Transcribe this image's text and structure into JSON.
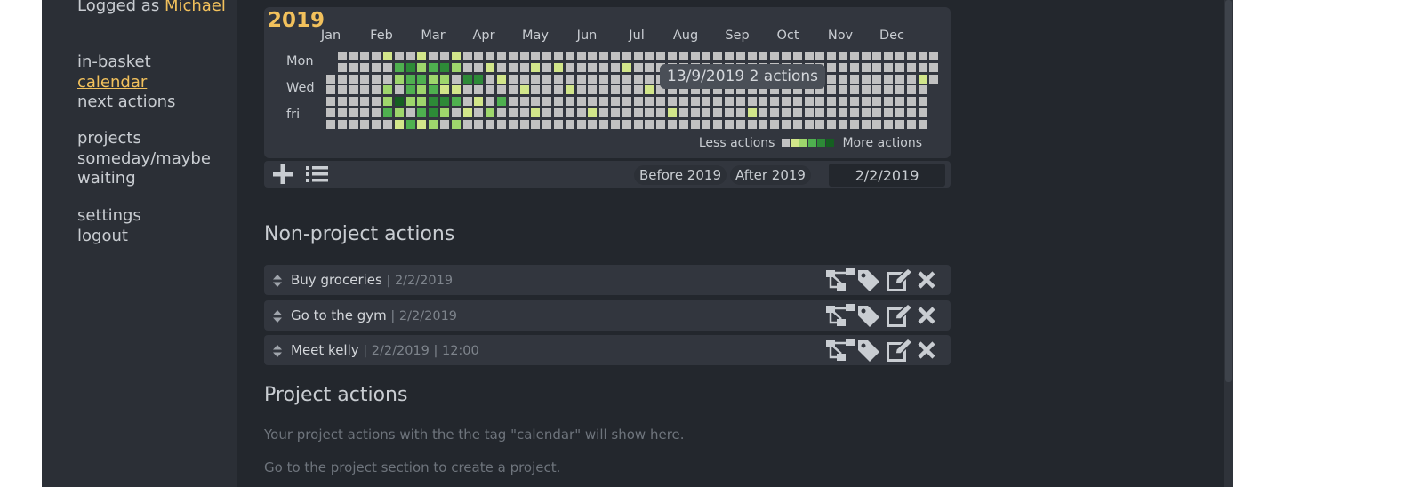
{
  "sidebar": {
    "logged_prefix": "Logged as ",
    "user_name": "Michael",
    "nav_main": [
      "in-basket",
      "calendar",
      "next actions"
    ],
    "nav_projects": [
      "projects",
      "someday/maybe",
      "waiting"
    ],
    "nav_account": [
      "settings",
      "logout"
    ],
    "active": "calendar"
  },
  "calendar": {
    "year": "2019",
    "months": [
      "Jan",
      "Feb",
      "Mar",
      "Apr",
      "May",
      "Jun",
      "Jul",
      "Aug",
      "Sep",
      "Oct",
      "Nov",
      "Dec"
    ],
    "day_labels": [
      "Mon",
      "Wed",
      "fri"
    ],
    "legend_less": "Less actions",
    "legend_more": "More actions",
    "legend_colors": [
      "#c1c1c1",
      "#d2e68a",
      "#9ed66c",
      "#4fb04f",
      "#2d8a37",
      "#155f21"
    ],
    "tooltip": "13/9/2019 2 actions",
    "empty_color": "#c1c1c1",
    "colors": [
      "#d2e68a",
      "#9ed66c",
      "#4fb04f",
      "#2d8a37",
      "#155f21"
    ],
    "highlights": [
      {
        "week": 5,
        "day": 0,
        "level": 0
      },
      {
        "week": 5,
        "day": 3,
        "level": 1
      },
      {
        "week": 5,
        "day": 4,
        "level": 1
      },
      {
        "week": 5,
        "day": 5,
        "level": 2
      },
      {
        "week": 6,
        "day": 1,
        "level": 2
      },
      {
        "week": 6,
        "day": 2,
        "level": 1
      },
      {
        "week": 6,
        "day": 4,
        "level": 4
      },
      {
        "week": 6,
        "day": 5,
        "level": 1
      },
      {
        "week": 6,
        "day": 6,
        "level": 0
      },
      {
        "week": 7,
        "day": 1,
        "level": 3
      },
      {
        "week": 7,
        "day": 2,
        "level": 2
      },
      {
        "week": 7,
        "day": 3,
        "level": 2
      },
      {
        "week": 7,
        "day": 4,
        "level": 1
      },
      {
        "week": 7,
        "day": 6,
        "level": 2
      },
      {
        "week": 8,
        "day": 0,
        "level": 0
      },
      {
        "week": 8,
        "day": 1,
        "level": 1
      },
      {
        "week": 8,
        "day": 2,
        "level": 2
      },
      {
        "week": 8,
        "day": 3,
        "level": 1
      },
      {
        "week": 8,
        "day": 4,
        "level": 1
      },
      {
        "week": 8,
        "day": 5,
        "level": 2
      },
      {
        "week": 8,
        "day": 6,
        "level": 0
      },
      {
        "week": 9,
        "day": 1,
        "level": 2
      },
      {
        "week": 9,
        "day": 2,
        "level": 1
      },
      {
        "week": 9,
        "day": 3,
        "level": 2
      },
      {
        "week": 9,
        "day": 4,
        "level": 3
      },
      {
        "week": 9,
        "day": 5,
        "level": 3
      },
      {
        "week": 9,
        "day": 6,
        "level": 1
      },
      {
        "week": 10,
        "day": 1,
        "level": 3
      },
      {
        "week": 10,
        "day": 2,
        "level": 1
      },
      {
        "week": 10,
        "day": 3,
        "level": 0
      },
      {
        "week": 10,
        "day": 4,
        "level": 3
      },
      {
        "week": 10,
        "day": 5,
        "level": 1
      },
      {
        "week": 11,
        "day": 0,
        "level": 0
      },
      {
        "week": 11,
        "day": 1,
        "level": 1
      },
      {
        "week": 11,
        "day": 3,
        "level": 0
      },
      {
        "week": 11,
        "day": 4,
        "level": 2
      },
      {
        "week": 11,
        "day": 6,
        "level": 1
      },
      {
        "week": 12,
        "day": 2,
        "level": 3
      },
      {
        "week": 12,
        "day": 5,
        "level": 0
      },
      {
        "week": 13,
        "day": 2,
        "level": 3
      },
      {
        "week": 13,
        "day": 4,
        "level": 0
      },
      {
        "week": 14,
        "day": 1,
        "level": 0
      },
      {
        "week": 14,
        "day": 5,
        "level": 1
      },
      {
        "week": 15,
        "day": 2,
        "level": 0
      },
      {
        "week": 15,
        "day": 4,
        "level": 2
      },
      {
        "week": 17,
        "day": 3,
        "level": 0
      },
      {
        "week": 18,
        "day": 1,
        "level": 0
      },
      {
        "week": 18,
        "day": 5,
        "level": 0
      },
      {
        "week": 20,
        "day": 1,
        "level": 0
      },
      {
        "week": 21,
        "day": 3,
        "level": 0
      },
      {
        "week": 23,
        "day": 5,
        "level": 0
      },
      {
        "week": 26,
        "day": 1,
        "level": 0
      },
      {
        "week": 28,
        "day": 3,
        "level": 0
      },
      {
        "week": 30,
        "day": 5,
        "level": 0
      },
      {
        "week": 37,
        "day": 5,
        "level": 0
      },
      {
        "week": 52,
        "day": 2,
        "level": 0
      }
    ]
  },
  "toolbar": {
    "add_icon": "plus-icon",
    "list_icon": "list-icon",
    "before_label": "Before 2019",
    "after_label": "After 2019",
    "date_value": "2/2/2019"
  },
  "non_project": {
    "title": "Non-project actions",
    "actions": [
      {
        "title": "Buy groceries",
        "meta": " | 2/2/2019"
      },
      {
        "title": "Go to the gym",
        "meta": " | 2/2/2019"
      },
      {
        "title": "Meet kelly",
        "meta": " | 2/2/2019  | 12:00"
      }
    ],
    "row_icons": [
      "hierarchy-icon",
      "tag-icon",
      "edit-icon",
      "close-icon"
    ]
  },
  "project": {
    "title": "Project actions",
    "hint1": "Your project actions with the the tag \"calendar\" will show here.",
    "hint2": "Go to the project section to create a project."
  }
}
